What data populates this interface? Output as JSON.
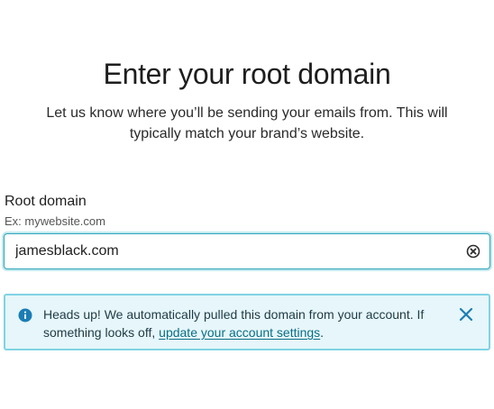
{
  "header": {
    "title": "Enter your root domain",
    "subtitle": "Let us know where you’ll be sending your emails from. This will typically match your brand’s website."
  },
  "form": {
    "label": "Root domain",
    "help_text": "Ex: mywebsite.com",
    "value": "jamesblack.com",
    "clear_icon": "clear-circle-x-icon"
  },
  "alert": {
    "icon": "info-icon",
    "text_before": "Heads up! We automatically pulled this domain from your account. If something looks off, ",
    "link_text": "update your account settings",
    "text_after": ".",
    "close_icon": "close-icon"
  },
  "colors": {
    "accent": "#2fa5b8",
    "alert_bg": "#e6f6fa",
    "alert_border": "#7fd3e3",
    "link": "#0a6e85",
    "icon": "#1b7db5"
  }
}
